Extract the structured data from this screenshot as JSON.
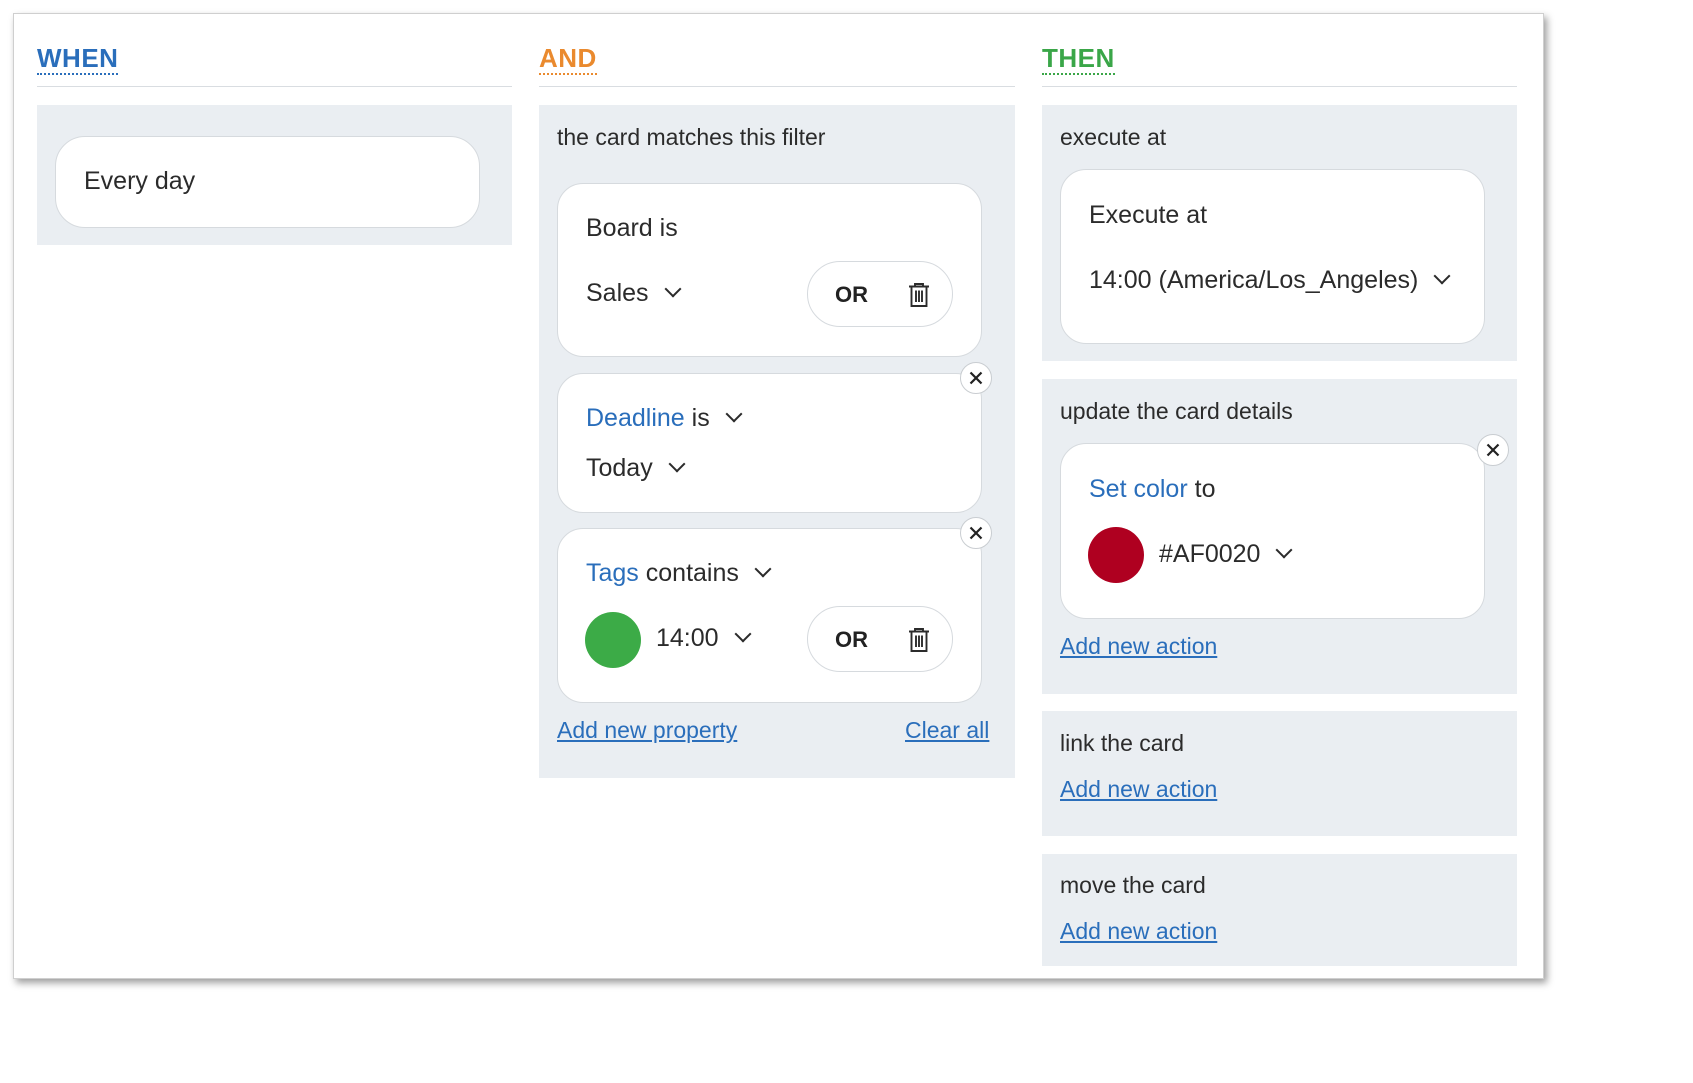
{
  "when": {
    "title": "WHEN",
    "trigger_label": "Every day"
  },
  "and": {
    "title": "AND",
    "filter_label": "the card matches this filter",
    "conditions": [
      {
        "property": "Board",
        "operator": "is",
        "value": "Sales",
        "or_label": "OR"
      },
      {
        "property": "Deadline",
        "operator": "is",
        "value": "Today"
      },
      {
        "property": "Tags",
        "operator": "contains",
        "value": "14:00",
        "or_label": "OR",
        "tag_color": "#3cab47"
      }
    ],
    "add_property": "Add new property",
    "clear_all": "Clear all"
  },
  "then": {
    "title": "THEN",
    "execute": {
      "label": "execute at",
      "card_title": "Execute at",
      "time": "14:00 (America/Los_Angeles)"
    },
    "update": {
      "label": "update the card details",
      "action": "Set color",
      "connector": "to",
      "color_value": "#AF0020",
      "swatch": "#AF0020",
      "add_action": "Add new action"
    },
    "link": {
      "label": "link the card",
      "add_action": "Add new action"
    },
    "move": {
      "label": "move the card",
      "add_action": "Add new action"
    }
  },
  "colors": {
    "when": "#2a6ebb",
    "and": "#ea8a2e",
    "then": "#3aa648",
    "panel_bg": "#eaeef2",
    "link": "#2a6ebb"
  }
}
